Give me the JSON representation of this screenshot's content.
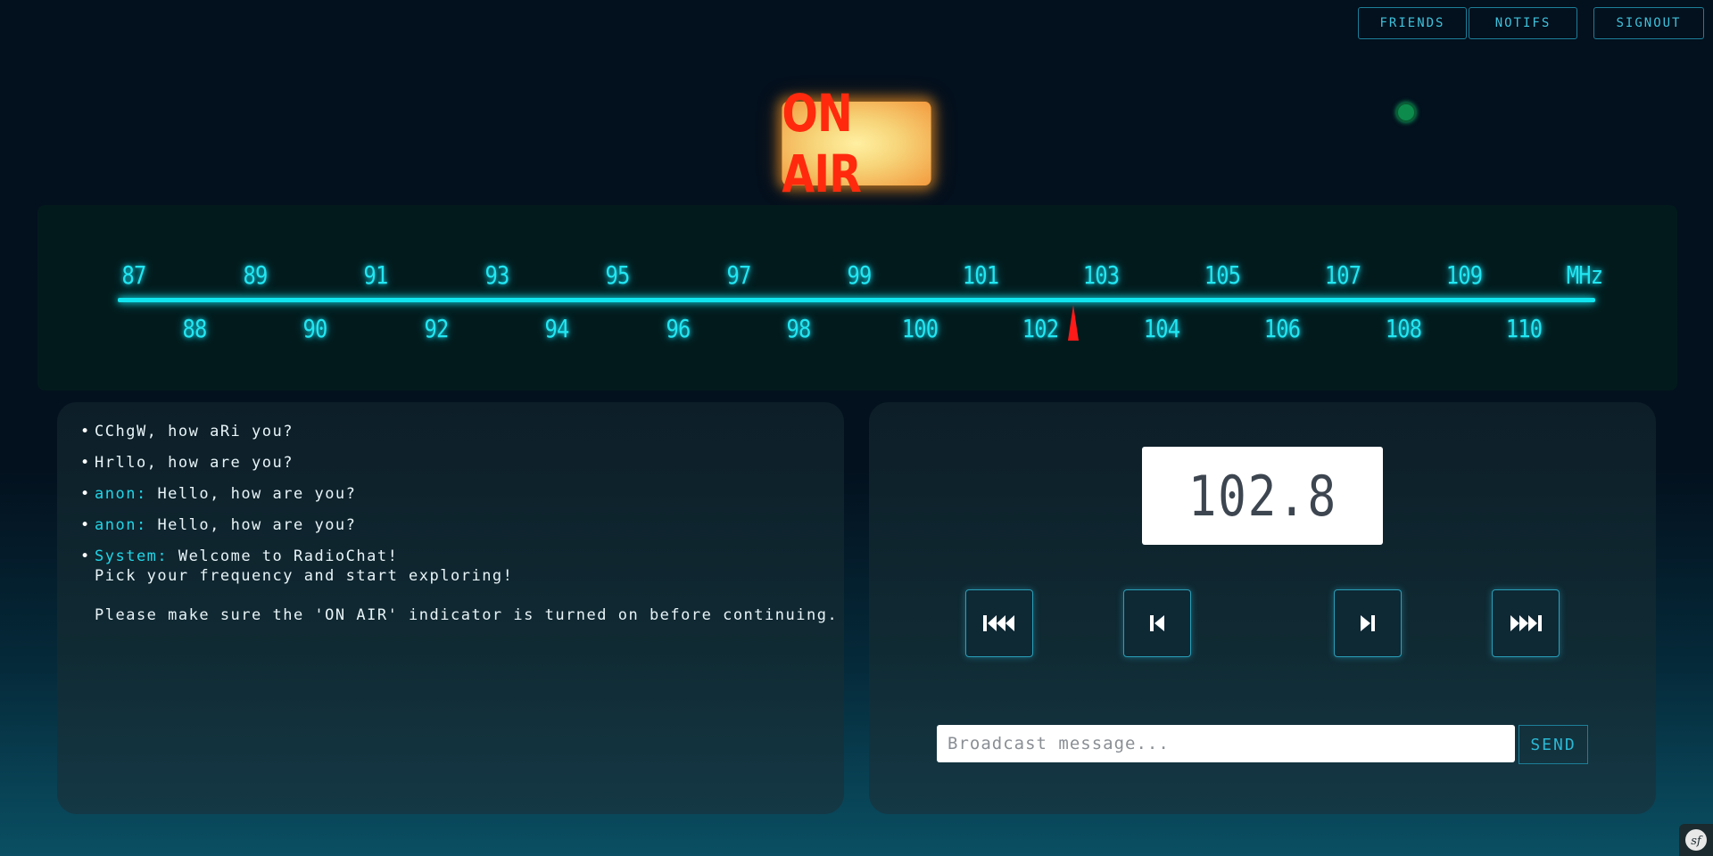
{
  "nav": {
    "friends": "FRIENDS",
    "notifs": "NOTIFS",
    "signout": "SIGNOUT"
  },
  "on_air": {
    "label": "ON AIR",
    "color": "#ff2a0d"
  },
  "status_indicator": {
    "state": "online",
    "color": "#0c8b4d"
  },
  "tuner": {
    "top_ticks": [
      "87",
      "89",
      "91",
      "93",
      "95",
      "97",
      "99",
      "101",
      "103",
      "105",
      "107",
      "109",
      "MHz"
    ],
    "bottom_ticks": [
      "88",
      "90",
      "92",
      "94",
      "96",
      "98",
      "100",
      "102",
      "104",
      "106",
      "108",
      "110"
    ],
    "current_frequency": 102.8,
    "needle_color": "#ff1a1a",
    "accent_color": "#11e4ee"
  },
  "chat": {
    "messages": [
      {
        "sender": "",
        "text": "CChgW, how aRi you?"
      },
      {
        "sender": "",
        "text": "Hrllo, how are you?"
      },
      {
        "sender": "anon:",
        "text": "Hello, how are you?"
      },
      {
        "sender": "anon:",
        "text": "Hello, how are you?"
      },
      {
        "sender": "System:",
        "text": "Welcome to RadioChat!\nPick your frequency and start exploring!\n\nPlease make sure the 'ON AIR' indicator is turned on before continuing."
      }
    ]
  },
  "controls": {
    "frequency_display": "102.8",
    "buttons": [
      {
        "name": "fast-back",
        "icon": "skip-back-double-icon"
      },
      {
        "name": "back",
        "icon": "skip-back-icon"
      },
      {
        "name": "forward",
        "icon": "skip-forward-icon"
      },
      {
        "name": "fast-forward",
        "icon": "skip-forward-double-icon"
      }
    ],
    "broadcast_placeholder": "Broadcast message...",
    "broadcast_value": "",
    "send_label": "SEND"
  },
  "corner_badge": {
    "icon": "symfony-logo-icon",
    "text": "sf"
  }
}
